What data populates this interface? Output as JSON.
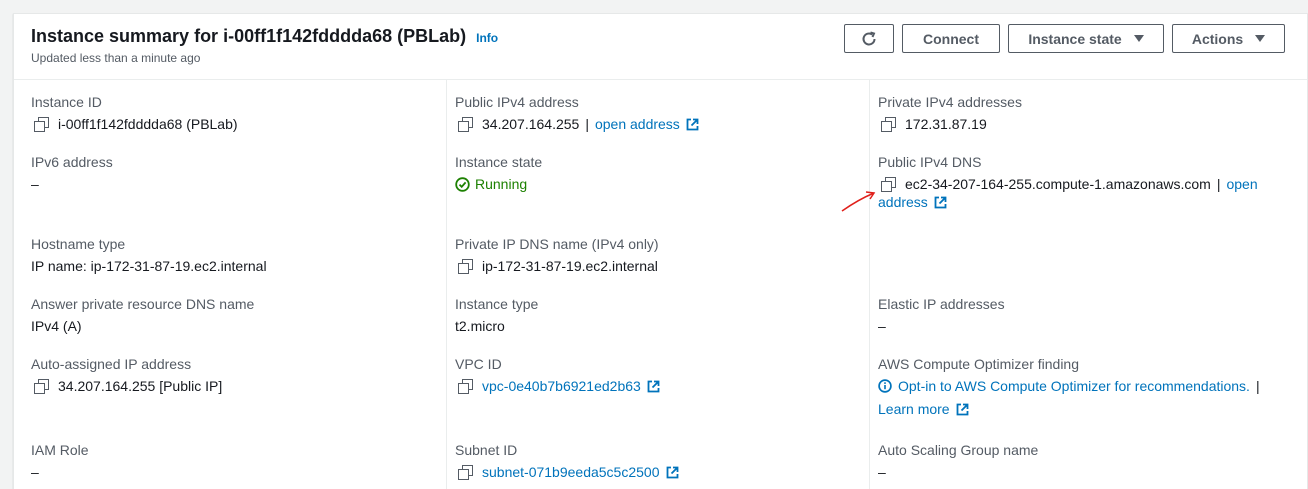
{
  "header": {
    "title": "Instance summary for i-00ff1f142fdddda68 (PBLab)",
    "info": "Info",
    "subtitle": "Updated less than a minute ago",
    "refresh_icon": "refresh-icon",
    "connect": "Connect",
    "instance_state": "Instance state",
    "actions": "Actions"
  },
  "fields": {
    "instance_id": {
      "label": "Instance ID",
      "value": "i-00ff1f142fdddda68 (PBLab)"
    },
    "public_ipv4": {
      "label": "Public IPv4 address",
      "value": "34.207.164.255",
      "sep": "|",
      "link": "open address"
    },
    "private_ipv4": {
      "label": "Private IPv4 addresses",
      "value": "172.31.87.19"
    },
    "ipv6": {
      "label": "IPv6 address",
      "value": "–"
    },
    "instance_state": {
      "label": "Instance state",
      "value": "Running"
    },
    "public_dns": {
      "label": "Public IPv4 DNS",
      "value": "ec2-34-207-164-255.compute-1.amazonaws.com",
      "sep": "|",
      "link_part1": "open",
      "link_part2": "address"
    },
    "hostname_type": {
      "label": "Hostname type",
      "value": "IP name: ip-172-31-87-19.ec2.internal"
    },
    "private_dns": {
      "label": "Private IP DNS name (IPv4 only)",
      "value": "ip-172-31-87-19.ec2.internal"
    },
    "answer_dns": {
      "label": "Answer private resource DNS name",
      "value": "IPv4 (A)"
    },
    "instance_type": {
      "label": "Instance type",
      "value": "t2.micro"
    },
    "elastic_ip": {
      "label": "Elastic IP addresses",
      "value": "–"
    },
    "auto_ip": {
      "label": "Auto-assigned IP address",
      "value": "34.207.164.255 [Public IP]"
    },
    "vpc": {
      "label": "VPC ID",
      "value": "vpc-0e40b7b6921ed2b63"
    },
    "optimizer": {
      "label": "AWS Compute Optimizer finding",
      "value": "Opt-in to AWS Compute Optimizer for recommendations.",
      "sep": "|",
      "learn_more": "Learn more"
    },
    "iam_role": {
      "label": "IAM Role",
      "value": "–"
    },
    "subnet": {
      "label": "Subnet ID",
      "value": "subnet-071b9eeda5c5c2500"
    },
    "asg": {
      "label": "Auto Scaling Group name",
      "value": "–"
    }
  },
  "colors": {
    "link": "#0073bb",
    "running": "#1d8102",
    "annotation_arrow": "#e0201b"
  }
}
